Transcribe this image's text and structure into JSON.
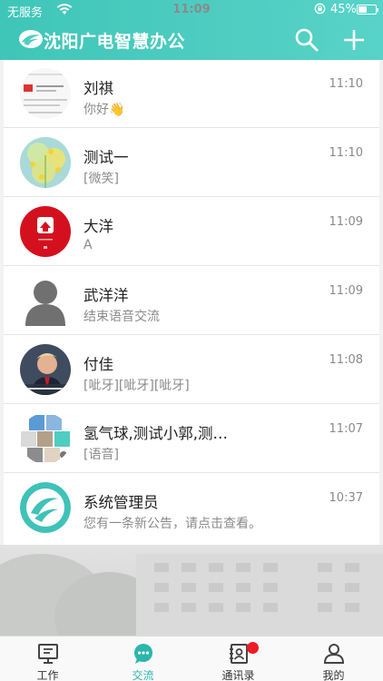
{
  "status_bar": {
    "carrier": "无服务",
    "time": "11:09",
    "battery": "45%",
    "battery_level": 0.45
  },
  "header": {
    "title": "沈阳广电智慧办公",
    "search_icon": "search-icon",
    "add_icon": "plus-icon"
  },
  "conversations": [
    {
      "name": "刘祺",
      "message": "你好👋",
      "time": "11:10",
      "avatar": "document-thumbnail"
    },
    {
      "name": "测试一",
      "message": "[微笑]",
      "time": "11:10",
      "avatar": "flower-photo"
    },
    {
      "name": "大洋",
      "message": "A",
      "time": "11:09",
      "avatar": "red-app-logo"
    },
    {
      "name": "武洋洋",
      "message": "结束语音交流",
      "time": "11:09",
      "avatar": "default-person"
    },
    {
      "name": "付佳",
      "message": "[呲牙][呲牙][呲牙]",
      "time": "11:08",
      "avatar": "person-photo"
    },
    {
      "name": "氢气球,测试小郭,测…",
      "message": "[语音]",
      "time": "11:07",
      "avatar": "group-collage"
    },
    {
      "name": "系统管理员",
      "message": "您有一条新公告，请点击查看。",
      "time": "10:37",
      "avatar": "app-logo"
    }
  ],
  "tabs": [
    {
      "label": "工作",
      "icon": "monitor-icon",
      "active": false
    },
    {
      "label": "交流",
      "icon": "chat-bubble-icon",
      "active": true
    },
    {
      "label": "通讯录",
      "icon": "contacts-icon",
      "active": false,
      "badge": true
    },
    {
      "label": "我的",
      "icon": "person-icon",
      "active": false
    }
  ],
  "colors": {
    "brand": "#4fcdc1",
    "active_tab": "#2bb6ab",
    "badge": "#ee1c25"
  }
}
